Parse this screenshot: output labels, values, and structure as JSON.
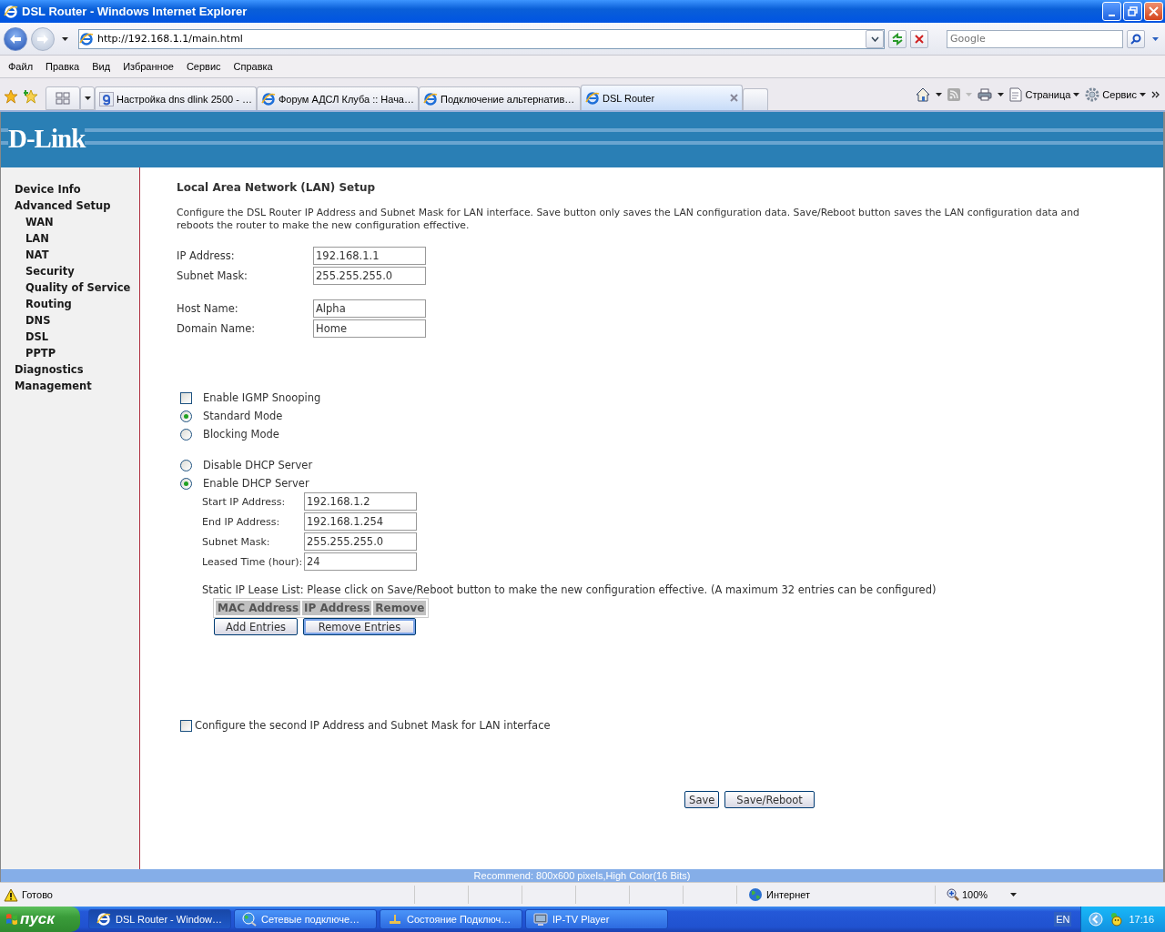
{
  "window": {
    "title": "DSL Router - Windows Internet Explorer"
  },
  "address_bar": {
    "url": "http://192.168.1.1/main.html"
  },
  "search": {
    "placeholder": "Google"
  },
  "menu": [
    "Файл",
    "Правка",
    "Вид",
    "Избранное",
    "Сервис",
    "Справка"
  ],
  "tabs": [
    {
      "label": "Настройка dns dlink 2500 - …",
      "kind": "google",
      "selected": false
    },
    {
      "label": "Форум АДСЛ Клуба :: Нача…",
      "kind": "ie",
      "selected": false
    },
    {
      "label": "Подключение альтернатив…",
      "kind": "ie",
      "selected": false
    },
    {
      "label": "DSL Router",
      "kind": "ie",
      "selected": true
    }
  ],
  "command_bar": [
    {
      "label": "Страница",
      "kind": "page"
    },
    {
      "label": "Сервис",
      "kind": "tools"
    }
  ],
  "page": {
    "logo": "D-Link",
    "sidebar": [
      {
        "label": "Device Info"
      },
      {
        "label": "Advanced Setup",
        "children": [
          {
            "label": "WAN"
          },
          {
            "label": "LAN"
          },
          {
            "label": "NAT"
          },
          {
            "label": "Security"
          },
          {
            "label": "Quality of Service"
          },
          {
            "label": "Routing"
          },
          {
            "label": "DNS"
          },
          {
            "label": "DSL"
          },
          {
            "label": "PPTP"
          }
        ]
      },
      {
        "label": "Diagnostics"
      },
      {
        "label": "Management"
      }
    ],
    "title": "Local Area Network (LAN) Setup",
    "description": "Configure the DSL Router IP Address and Subnet Mask for LAN interface.  Save button only saves the LAN configuration data.  Save/Reboot button saves the LAN configuration data and reboots the router to make the new configuration effective.",
    "field_groups": [
      [
        {
          "label": "IP Address:",
          "value": "192.168.1.1"
        },
        {
          "label": "Subnet Mask:",
          "value": "255.255.255.0"
        }
      ],
      [
        {
          "label": "Host Name:",
          "value": "Alpha"
        },
        {
          "label": "Domain Name:",
          "value": "Home"
        }
      ]
    ],
    "igmp": {
      "label": "Enable IGMP Snooping",
      "checked": false
    },
    "igmp_modes": [
      {
        "label": "Standard Mode",
        "selected": true
      },
      {
        "label": "Blocking Mode",
        "selected": false
      }
    ],
    "dhcp_modes": [
      {
        "label": "Disable DHCP Server",
        "selected": false
      },
      {
        "label": "Enable DHCP Server",
        "selected": true
      }
    ],
    "dhcp_fields": [
      {
        "label": "Start IP Address:",
        "value": "192.168.1.2"
      },
      {
        "label": "End IP Address:",
        "value": "192.168.1.254"
      },
      {
        "label": "Subnet Mask:",
        "value": "255.255.255.0"
      },
      {
        "label": "Leased Time (hour):",
        "value": "24"
      }
    ],
    "lease_note": "Static IP Lease List: Please click on Save/Reboot button to make the new configuration effective. (A maximum 32 entries can be configured)",
    "lease_table": {
      "columns": [
        "MAC Address",
        "IP Address",
        "Remove"
      ]
    },
    "lease_buttons": [
      {
        "label": "Add Entries",
        "focused": false
      },
      {
        "label": "Remove Entries",
        "focused": true
      }
    ],
    "second_ip": {
      "label": "Configure the second IP Address and Subnet Mask for LAN interface",
      "checked": false
    },
    "buttons": [
      "Save",
      "Save/Reboot"
    ],
    "footer": "Recommend: 800x600 pixels,High Color(16 Bits)"
  },
  "status_bar": {
    "text": "Готово",
    "zone": "Интернет",
    "zoom": "100%"
  },
  "taskbar": {
    "start": "пуск",
    "items": [
      {
        "label": "DSL Router - Window…",
        "kind": "ie",
        "selected": true
      },
      {
        "label": "Сетевые подключе…",
        "kind": "network",
        "selected": false
      },
      {
        "label": "Состояние Подключ…",
        "kind": "connection",
        "selected": false
      },
      {
        "label": "IP-TV Player",
        "kind": "tv",
        "selected": false
      }
    ],
    "language": "EN",
    "clock": "17:16"
  }
}
